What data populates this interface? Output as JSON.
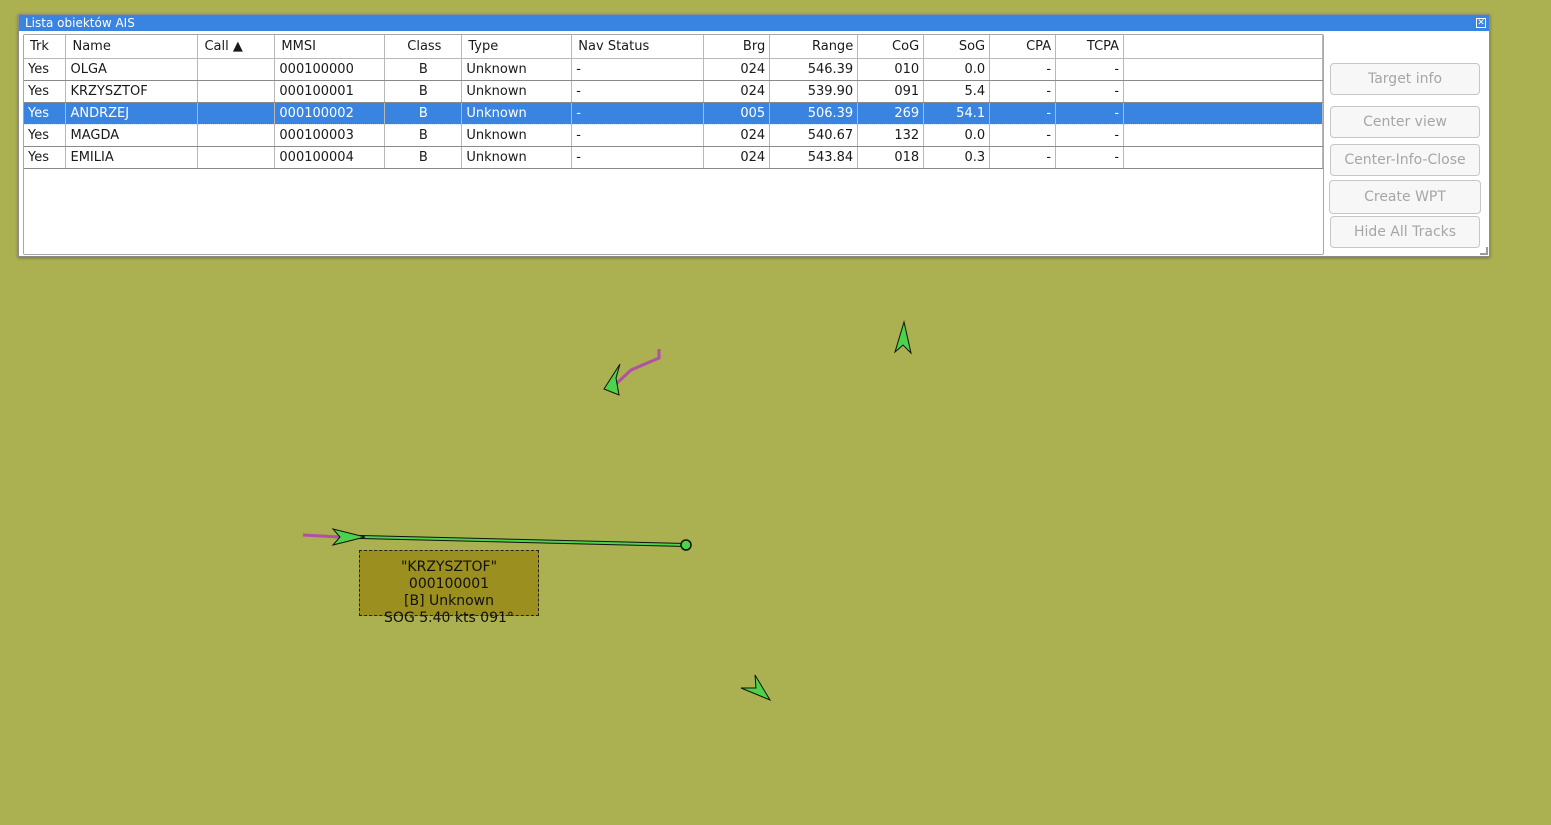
{
  "window": {
    "title": "Lista obiektów AIS",
    "close_glyph": "✕"
  },
  "table": {
    "columns": [
      {
        "key": "trk",
        "label": "Trk"
      },
      {
        "key": "name",
        "label": "Name"
      },
      {
        "key": "call",
        "label": "Call ▲"
      },
      {
        "key": "mmsi",
        "label": "MMSI"
      },
      {
        "key": "class",
        "label": "Class"
      },
      {
        "key": "type",
        "label": "Type"
      },
      {
        "key": "nav",
        "label": "Nav Status"
      },
      {
        "key": "brg",
        "label": "Brg"
      },
      {
        "key": "range",
        "label": "Range"
      },
      {
        "key": "cog",
        "label": "CoG"
      },
      {
        "key": "sog",
        "label": "SoG"
      },
      {
        "key": "cpa",
        "label": "CPA"
      },
      {
        "key": "tcpa",
        "label": "TCPA"
      },
      {
        "key": "extra",
        "label": ""
      }
    ],
    "rows": [
      {
        "trk": "Yes",
        "name": "OLGA",
        "call": "",
        "mmsi": "000100000",
        "class": "B",
        "type": "Unknown",
        "nav": "-",
        "brg": "024",
        "range": "546.39",
        "cog": "010",
        "sog": "0.0",
        "cpa": "-",
        "tcpa": "-",
        "extra": ""
      },
      {
        "trk": "Yes",
        "name": "KRZYSZTOF",
        "call": "",
        "mmsi": "000100001",
        "class": "B",
        "type": "Unknown",
        "nav": "-",
        "brg": "024",
        "range": "539.90",
        "cog": "091",
        "sog": "5.4",
        "cpa": "-",
        "tcpa": "-",
        "extra": ""
      },
      {
        "trk": "Yes",
        "name": "ANDRZEJ",
        "call": "",
        "mmsi": "000100002",
        "class": "B",
        "type": "Unknown",
        "nav": "-",
        "brg": "005",
        "range": "506.39",
        "cog": "269",
        "sog": "54.1",
        "cpa": "-",
        "tcpa": "-",
        "extra": ""
      },
      {
        "trk": "Yes",
        "name": "MAGDA",
        "call": "",
        "mmsi": "000100003",
        "class": "B",
        "type": "Unknown",
        "nav": "-",
        "brg": "024",
        "range": "540.67",
        "cog": "132",
        "sog": "0.0",
        "cpa": "-",
        "tcpa": "-",
        "extra": ""
      },
      {
        "trk": "Yes",
        "name": "EMILIA",
        "call": "",
        "mmsi": "000100004",
        "class": "B",
        "type": "Unknown",
        "nav": "-",
        "brg": "024",
        "range": "543.84",
        "cog": "018",
        "sog": "0.3",
        "cpa": "-",
        "tcpa": "-",
        "extra": ""
      }
    ],
    "selected_row": 2
  },
  "buttons": {
    "target_info": "Target info",
    "center_view": "Center view",
    "center_info_close": "Center-Info-Close",
    "create_wpt": "Create WPT",
    "hide_all_tracks": "Hide All Tracks"
  },
  "map": {
    "background": "#abb051",
    "target_fill": "#4cd34a",
    "track_color": "#b24fa6",
    "label": {
      "line1": "\"KRZYSZTOF\" 000100001",
      "line2": "[B] Unknown",
      "line3": "SOG 5.40 kts 091°"
    }
  }
}
